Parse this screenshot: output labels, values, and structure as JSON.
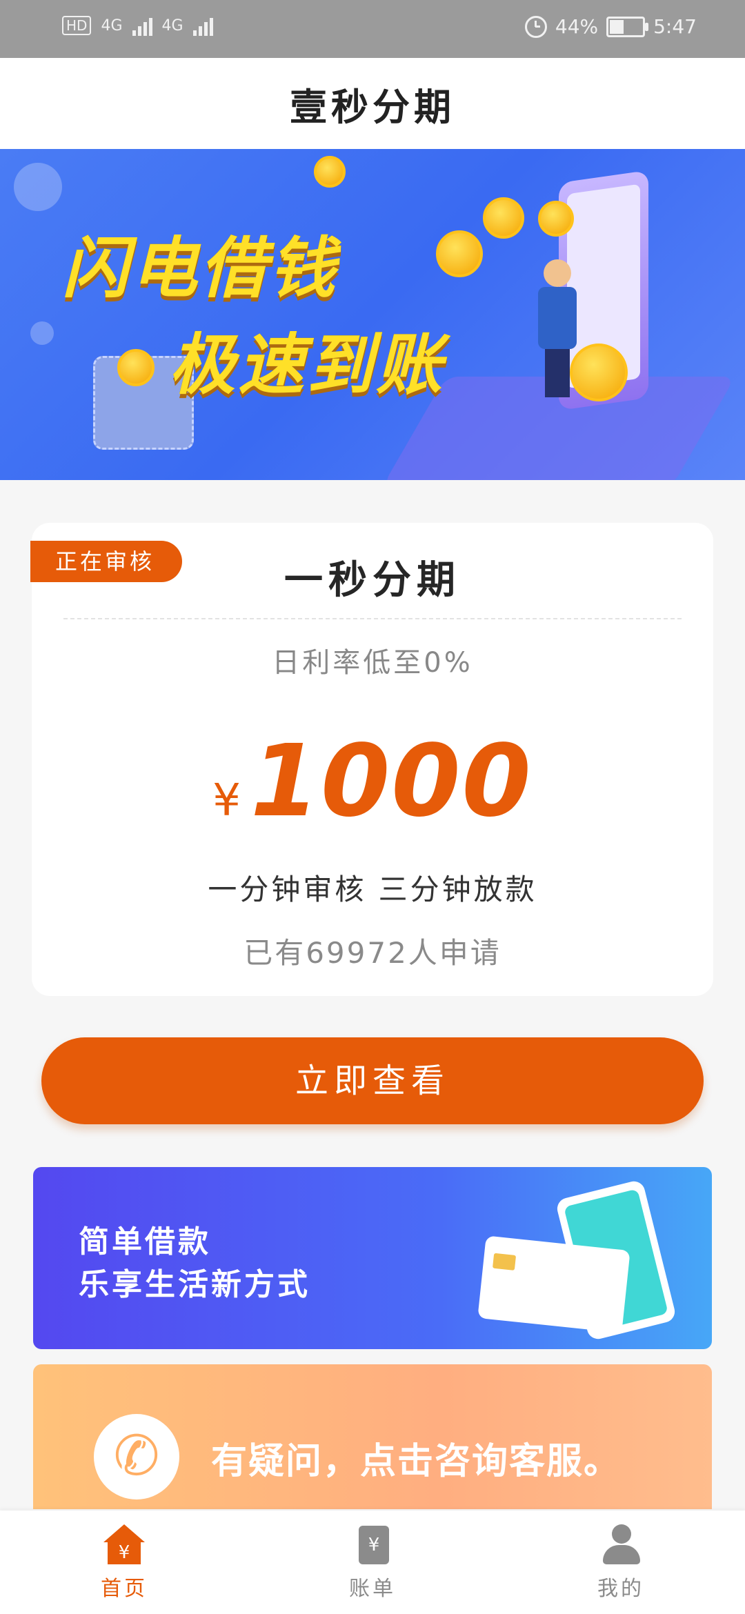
{
  "status_bar": {
    "network_left": "HD",
    "sim1": "4G",
    "sim2": "4G",
    "battery_text": "44%",
    "time": "5:47",
    "battery_level": 0.44
  },
  "header": {
    "title": "壹秒分期"
  },
  "banner": {
    "line1": "闪电借钱",
    "line2": "极速到账"
  },
  "loan_card": {
    "badge": "正在审核",
    "title": "一秒分期",
    "rate_text": "日利率低至0%",
    "currency": "¥",
    "amount": "1000",
    "subtitle": "一分钟审核  三分钟放款",
    "applied": "已有69972人申请"
  },
  "cta": {
    "label": "立即查看"
  },
  "promo1": {
    "line1": "简单借款",
    "line2": "乐享生活新方式"
  },
  "promo2": {
    "text": "有疑问，点击咨询客服。"
  },
  "tabbar": {
    "items": [
      {
        "label": "首页",
        "icon": "home-icon",
        "active": true
      },
      {
        "label": "账单",
        "icon": "bill-icon",
        "active": false
      },
      {
        "label": "我的",
        "icon": "user-icon",
        "active": false
      }
    ]
  },
  "colors": {
    "accent": "#e65b09",
    "inactive": "#8b8b8b"
  }
}
